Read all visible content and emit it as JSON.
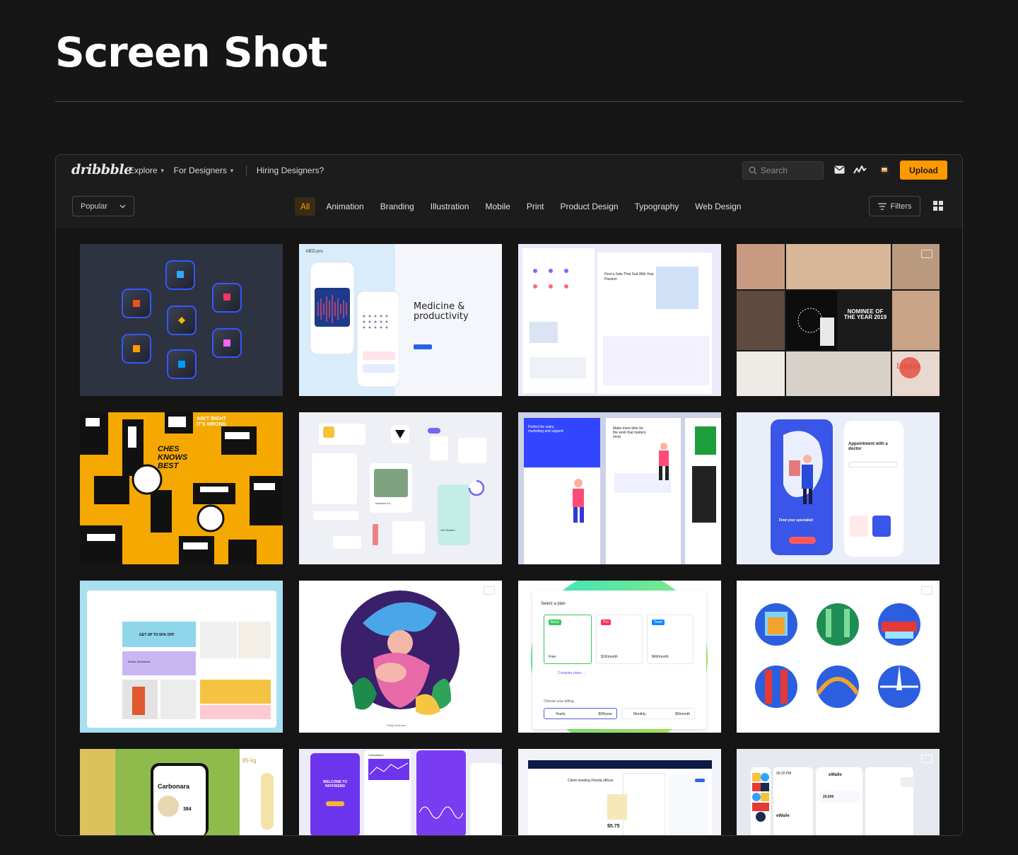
{
  "page": {
    "heading": "Screen Shot"
  },
  "topbar": {
    "logo": "dribbble",
    "nav": [
      {
        "label": "Explore",
        "dropdown": true
      },
      {
        "label": "For Designers",
        "dropdown": true
      }
    ],
    "hiring": "Hiring Designers?",
    "search_placeholder": "Search",
    "upload_label": "Upload"
  },
  "filterbar": {
    "sort_value": "Popular",
    "categories": [
      "All",
      "Animation",
      "Branding",
      "Illustration",
      "Mobile",
      "Print",
      "Product Design",
      "Typography",
      "Web Design"
    ],
    "active_category": "All",
    "filters_label": "Filters"
  },
  "shots": [
    {
      "theme": "app icons"
    },
    {
      "theme": "medicine",
      "title": "Medicine &",
      "title2": "productivity",
      "brand": "MED.pro"
    },
    {
      "theme": "jobs",
      "text": "Find a Jobs That Suit With Your Passion"
    },
    {
      "theme": "editorial",
      "text": "NOMINEE OF THE YEAR 2019",
      "text2": "Limnia"
    },
    {
      "theme": "typographic poster",
      "text": "AIN'T RIGHT IT'S WRONG",
      "text2": "CHES KNOWS BEST"
    },
    {
      "theme": "ui components",
      "text": "Vuexxxx 4.0",
      "text2": "Get Started"
    },
    {
      "theme": "landing pages",
      "text": "Perfect for sales, marketing and support",
      "text2": "Make more time for the work that matters most"
    },
    {
      "theme": "doctor app",
      "text": "Appointment with a doctor",
      "text2": "Find your specialist!"
    },
    {
      "theme": "shop",
      "text": "GET UP TO 50% OFF",
      "text2": "Winter Weekends"
    },
    {
      "theme": "illustration",
      "text": "©ianji Illustrator"
    },
    {
      "theme": "pricing",
      "text": "Select a plan",
      "plans": [
        "Basic",
        "Pro",
        "Team"
      ],
      "prices": [
        "Free",
        "$19/month",
        "$49/month"
      ],
      "billing": "Choose your billing",
      "yearly": "Yearly",
      "monthly": "Monthly",
      "yearly_price": "$99/year",
      "monthly_price": "$9/month",
      "compare": "Compare plans →"
    },
    {
      "theme": "bridges"
    },
    {
      "theme": "carbonara",
      "text": "Carbonara",
      "text2": "85 kg",
      "text3": "384"
    },
    {
      "theme": "payfriend",
      "text": "WELCOME TO PAYFRIEND",
      "text2": "Comparison"
    },
    {
      "theme": "payfit",
      "text": "Client meeting Florida offices",
      "text2": "$5.75"
    },
    {
      "theme": "ewallet",
      "text": "eWalle",
      "text2": "06:20 PM",
      "text3": "20,600"
    }
  ]
}
